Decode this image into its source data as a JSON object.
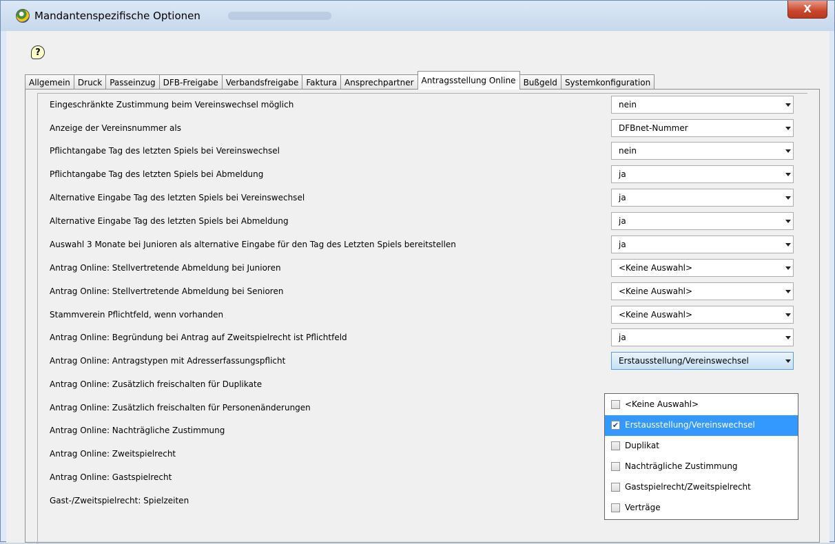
{
  "window": {
    "title": "Mandantenspezifische Optionen",
    "close_label": "X"
  },
  "help": {
    "label": "?"
  },
  "tabs": [
    {
      "label": "Allgemein"
    },
    {
      "label": "Druck"
    },
    {
      "label": "Passeinzug"
    },
    {
      "label": "DFB-Freigabe"
    },
    {
      "label": "Verbandsfreigabe"
    },
    {
      "label": "Faktura"
    },
    {
      "label": "Ansprechpartner"
    },
    {
      "label": "Antragsstellung Online",
      "active": true
    },
    {
      "label": "Bußgeld"
    },
    {
      "label": "Systemkonfiguration"
    }
  ],
  "options": [
    {
      "label": "Eingeschränkte Zustimmung beim Vereinswechsel möglich",
      "value": "nein"
    },
    {
      "label": "Anzeige der Vereinsnummer als",
      "value": "DFBnet-Nummer"
    },
    {
      "label": "Pflichtangabe Tag des letzten Spiels bei Vereinswechsel",
      "value": "nein"
    },
    {
      "label": "Pflichtangabe Tag des letzten Spiels bei Abmeldung",
      "value": "ja"
    },
    {
      "label": "Alternative Eingabe Tag des letzten Spiels bei Vereinswechsel",
      "value": "ja"
    },
    {
      "label": "Alternative Eingabe Tag des letzten Spiels bei Abmeldung",
      "value": "ja"
    },
    {
      "label": "Auswahl 3 Monate bei Junioren als alternative Eingabe für den Tag des Letzten Spiels bereitstellen",
      "value": "ja"
    },
    {
      "label": "Antrag Online: Stellvertretende Abmeldung bei Junioren",
      "value": "<Keine Auswahl>"
    },
    {
      "label": "Antrag Online: Stellvertretende Abmeldung bei Senioren",
      "value": "<Keine Auswahl>"
    },
    {
      "label": "Stammverein Pflichtfeld, wenn vorhanden",
      "value": "<Keine Auswahl>"
    },
    {
      "label": "Antrag Online: Begründung bei Antrag auf Zweitspielrecht ist Pflichtfeld",
      "value": "ja"
    },
    {
      "label": "Antrag Online: Antragstypen mit Adresserfassungspflicht",
      "value": "Erstausstellung/Vereinswechsel",
      "open": true
    },
    {
      "label": "Antrag Online: Zusätzlich freischalten für Duplikate",
      "value": ""
    },
    {
      "label": "Antrag Online: Zusätzlich freischalten für Personenänderungen",
      "value": ""
    },
    {
      "label": "Antrag Online: Nachträgliche Zustimmung",
      "value": ""
    },
    {
      "label": "Antrag Online: Zweitspielrecht",
      "value": ""
    },
    {
      "label": "Antrag Online: Gastspielrecht",
      "value": ""
    },
    {
      "label": "Gast-/Zweitspielrecht: Spielzeiten",
      "value": "<Keine Auswahl>"
    }
  ],
  "dropdown": {
    "items": [
      {
        "label": "<Keine Auswahl>",
        "checked": false
      },
      {
        "label": "Erstausstellung/Vereinswechsel",
        "checked": true,
        "selected": true
      },
      {
        "label": "Duplikat",
        "checked": false
      },
      {
        "label": "Nachträgliche Zustimmung",
        "checked": false
      },
      {
        "label": "Gastspielrecht/Zweitspielrecht",
        "checked": false
      },
      {
        "label": "Verträge",
        "checked": false
      }
    ],
    "check_mark": "✔"
  }
}
